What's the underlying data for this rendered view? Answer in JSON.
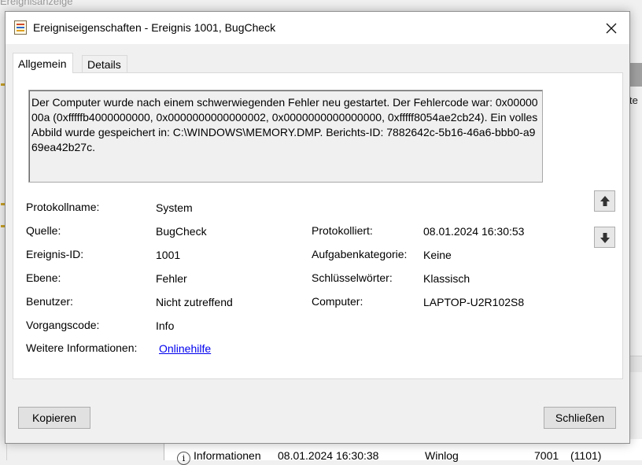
{
  "background": {
    "app_title": "Ereignisanzeige",
    "right_text": "te",
    "rows": [
      {
        "level": "Informationen",
        "date": "08.01.2024 16:30:38",
        "source": "Winlog",
        "id": "7001",
        "category": "(1101)"
      }
    ]
  },
  "dialog": {
    "title": "Ereigniseigenschaften - Ereignis 1001, BugCheck",
    "tabs": [
      "Allgemein",
      "Details"
    ],
    "description": "Der Computer wurde nach einem schwerwiegenden Fehler neu gestartet. Der Fehlercode war: 0x0000000a (0xfffffb4000000000, 0x0000000000000002, 0x0000000000000000, 0xfffff8054ae2cb24). Ein volles Abbild wurde gespeichert in: C:\\WINDOWS\\MEMORY.DMP. Berichts-ID: 7882642c-5b16-46a6-bbb0-a969ea42b27c.",
    "fields": {
      "protokollname": {
        "label": "Protokollname:",
        "value": "System"
      },
      "quelle": {
        "label": "Quelle:",
        "value": "BugCheck"
      },
      "ereignis_id": {
        "label": "Ereignis-ID:",
        "value": "1001"
      },
      "ebene": {
        "label": "Ebene:",
        "value": "Fehler"
      },
      "benutzer": {
        "label": "Benutzer:",
        "value": "Nicht zutreffend"
      },
      "vorgangscode": {
        "label": "Vorgangscode:",
        "value": "Info"
      },
      "weitere": {
        "label": "Weitere Informationen:",
        "value": "Onlinehilfe"
      },
      "protokolliert": {
        "label": "Protokolliert:",
        "value": "08.01.2024 16:30:53"
      },
      "aufgabenkategorie": {
        "label": "Aufgabenkategorie:",
        "value": "Keine"
      },
      "schluesselwoerter": {
        "label": "Schlüsselwörter:",
        "value": "Klassisch"
      },
      "computer": {
        "label": "Computer:",
        "value": "LAPTOP-U2R102S8"
      }
    },
    "buttons": {
      "copy": "Kopieren",
      "close": "Schließen"
    },
    "icons": {
      "close": "close-icon",
      "up": "arrow-up-icon",
      "down": "arrow-down-icon"
    }
  }
}
